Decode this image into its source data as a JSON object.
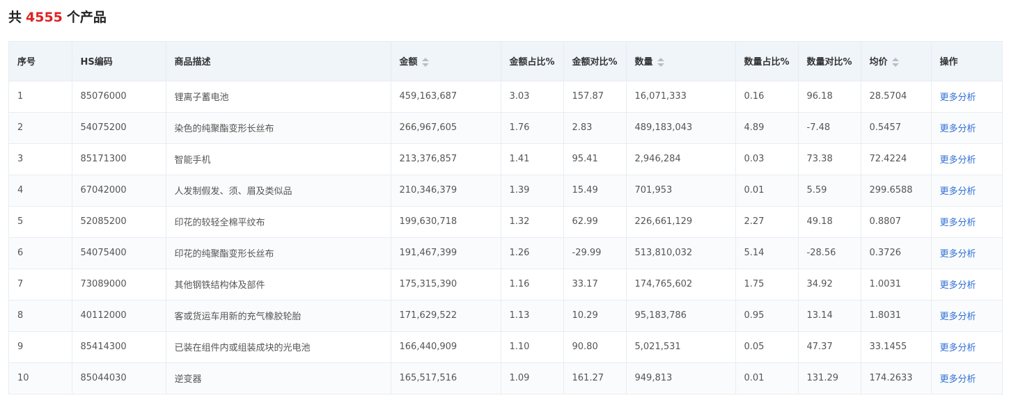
{
  "summary": {
    "prefix": "共",
    "count": "4555",
    "suffix": "个产品"
  },
  "colors": {
    "count_red": "#e02020",
    "link_blue": "#2f6fd6",
    "header_bg": "#f0f5fa"
  },
  "table": {
    "columns": [
      "序号",
      "HS编码",
      "商品描述",
      "金额",
      "金额占比%",
      "金额对比%",
      "数量",
      "数量占比%",
      "数量对比%",
      "均价",
      "操作"
    ],
    "sortable_icons": [
      "sort-icon",
      "sort-icon",
      "sort-icon"
    ],
    "rows": [
      [
        "1",
        "85076000",
        "锂离子蓄电池",
        "459,163,687",
        "3.03",
        "157.87",
        "16,071,333",
        "0.16",
        "96.18",
        "28.5704",
        "更多分析"
      ],
      [
        "2",
        "54075200",
        "染色的纯聚酯变形长丝布",
        "266,967,605",
        "1.76",
        "2.83",
        "489,183,043",
        "4.89",
        "-7.48",
        "0.5457",
        "更多分析"
      ],
      [
        "3",
        "85171300",
        "智能手机",
        "213,376,857",
        "1.41",
        "95.41",
        "2,946,284",
        "0.03",
        "73.38",
        "72.4224",
        "更多分析"
      ],
      [
        "4",
        "67042000",
        "人发制假发、须、眉及类似品",
        "210,346,379",
        "1.39",
        "15.49",
        "701,953",
        "0.01",
        "5.59",
        "299.6588",
        "更多分析"
      ],
      [
        "5",
        "52085200",
        "印花的较轻全棉平纹布",
        "199,630,718",
        "1.32",
        "62.99",
        "226,661,129",
        "2.27",
        "49.18",
        "0.8807",
        "更多分析"
      ],
      [
        "6",
        "54075400",
        "印花的纯聚酯变形长丝布",
        "191,467,399",
        "1.26",
        "-29.99",
        "513,810,032",
        "5.14",
        "-28.56",
        "0.3726",
        "更多分析"
      ],
      [
        "7",
        "73089000",
        "其他钢铁结构体及部件",
        "175,315,390",
        "1.16",
        "33.17",
        "174,765,602",
        "1.75",
        "34.92",
        "1.0031",
        "更多分析"
      ],
      [
        "8",
        "40112000",
        "客或货运车用新的充气橡胶轮胎",
        "171,629,522",
        "1.13",
        "10.29",
        "95,183,786",
        "0.95",
        "13.14",
        "1.8031",
        "更多分析"
      ],
      [
        "9",
        "85414300",
        "已装在组件内或组装成块的光电池",
        "166,440,909",
        "1.10",
        "90.80",
        "5,021,531",
        "0.05",
        "47.37",
        "33.1455",
        "更多分析"
      ],
      [
        "10",
        "85044030",
        "逆变器",
        "165,517,516",
        "1.09",
        "161.27",
        "949,813",
        "0.01",
        "131.29",
        "174.2633",
        "更多分析"
      ]
    ]
  }
}
